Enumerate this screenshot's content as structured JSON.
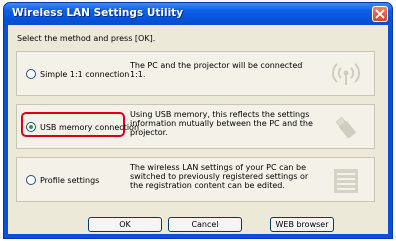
{
  "window": {
    "title": "Wireless LAN Settings Utility"
  },
  "prompt": "Select the method and press [OK].",
  "options": [
    {
      "label": "Simple 1:1 connection",
      "desc": [
        "The PC and the projector will be connected",
        "1:1."
      ],
      "selected": false,
      "icon": "wireless-signal-icon"
    },
    {
      "label": "USB memory connection",
      "desc": [
        "Using USB memory, this reflects the settings",
        "information mutually between the PC and the",
        "projector."
      ],
      "selected": true,
      "icon": "usb-memory-icon"
    },
    {
      "label": "Profile settings",
      "desc": [
        "The wireless LAN settings of your PC can be",
        "switched to previously registered settings or",
        "the registration content can be edited."
      ],
      "selected": false,
      "icon": "profile-list-icon"
    }
  ],
  "buttons": {
    "ok": "OK",
    "cancel": "Cancel",
    "web": "WEB browser"
  },
  "colors": {
    "titlebar": "#0d5fe8",
    "highlight": "#d9001a",
    "icon": "#d2cfc2"
  }
}
